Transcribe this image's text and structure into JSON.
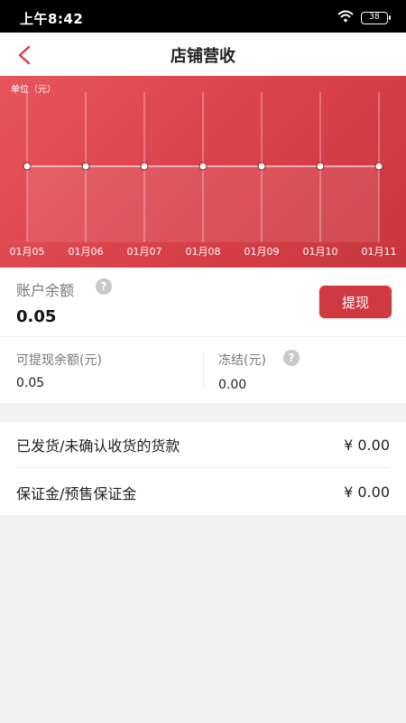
{
  "status_bar": {
    "time": "上午8:42",
    "battery": "38"
  },
  "header": {
    "title": "店铺营收"
  },
  "chart_data": {
    "type": "line",
    "unit_label": "单位（元）",
    "categories": [
      "01月05",
      "01月06",
      "01月07",
      "01月08",
      "01月09",
      "01月10",
      "01月11"
    ],
    "values": [
      0,
      0,
      0,
      0,
      0,
      0,
      0
    ],
    "grid": true,
    "colors": {
      "background": "#d9404a",
      "line": "#ffffff"
    }
  },
  "account": {
    "balance_label": "账户余额",
    "balance_value": "0.05",
    "withdraw_label": "提现",
    "withdrawable_label": "可提现余额(元)",
    "withdrawable_value": "0.05",
    "frozen_label": "冻结(元)",
    "frozen_value": "0.00"
  },
  "list": {
    "items": [
      {
        "label": "已发货/未确认收货的货款",
        "amount": "¥ 0.00"
      },
      {
        "label": "保证金/预售保证金",
        "amount": "¥ 0.00"
      }
    ]
  },
  "colors": {
    "accent": "#cf3a42"
  }
}
